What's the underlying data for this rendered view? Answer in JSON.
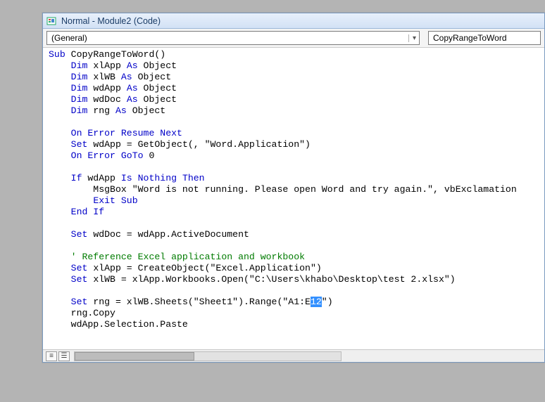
{
  "window": {
    "title": "Normal - Module2 (Code)"
  },
  "dropdowns": {
    "object": "(General)",
    "procedure": "CopyRangeToWord"
  },
  "code": {
    "sub_line": {
      "kw1": "Sub",
      "name": " CopyRangeToWord()"
    },
    "dim1": {
      "kw": "Dim",
      "var": " xlApp ",
      "as": "As",
      "type": " Object"
    },
    "dim2": {
      "kw": "Dim",
      "var": " xlWB ",
      "as": "As",
      "type": " Object"
    },
    "dim3": {
      "kw": "Dim",
      "var": " wdApp ",
      "as": "As",
      "type": " Object"
    },
    "dim4": {
      "kw": "Dim",
      "var": " wdDoc ",
      "as": "As",
      "type": " Object"
    },
    "dim5": {
      "kw": "Dim",
      "var": " rng ",
      "as": "As",
      "type": " Object"
    },
    "onerr1": "On Error Resume Next",
    "set_wdapp": {
      "kw": "Set",
      "rest": " wdApp = GetObject(, \"Word.Application\")"
    },
    "onerr2": {
      "kw": "On Error GoTo",
      "rest": " 0"
    },
    "if_line": {
      "kw1": "If",
      "mid": " wdApp ",
      "kw2": "Is Nothing Then"
    },
    "msgbox": "        MsgBox \"Word is not running. Please open Word and try again.\", vbExclamation",
    "exit": "Exit Sub",
    "endif": "End If",
    "set_doc": {
      "kw": "Set",
      "rest": " wdDoc = wdApp.ActiveDocument"
    },
    "comment": "    ' Reference Excel application and workbook",
    "set_xlapp": {
      "kw": "Set",
      "rest": " xlApp = CreateObject(\"Excel.Application\")"
    },
    "set_xlwb": {
      "kw": "Set",
      "rest": " xlWB = xlApp.Workbooks.Open(\"C:\\Users\\khabo\\Desktop\\test 2.xlsx\")"
    },
    "set_rng_pre": {
      "kw": "Set",
      "rest": " rng = xlWB.Sheets(\"Sheet1\").Range(\"A1:E"
    },
    "set_rng_sel": "12",
    "set_rng_post": "\")",
    "rngcopy": "    rng.Copy",
    "paste": "    wdApp.Selection.Paste"
  }
}
